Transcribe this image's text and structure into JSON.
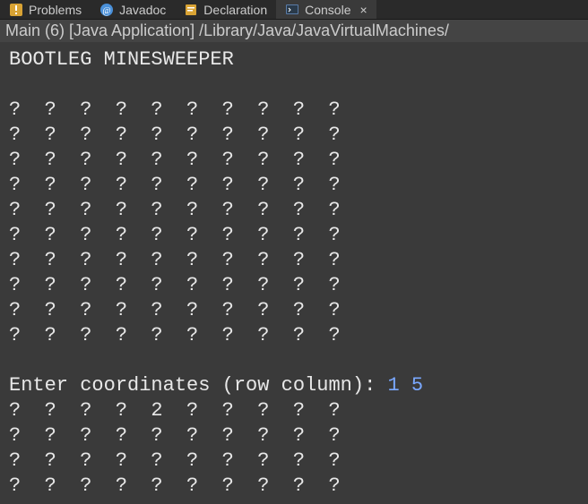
{
  "tabs": {
    "problems": "Problems",
    "javadoc": "Javadoc",
    "declaration": "Declaration",
    "console": "Console"
  },
  "launch_info": "Main (6) [Java Application] /Library/Java/JavaVirtualMachines/",
  "console_output": {
    "title": "BOOTLEG MINESWEEPER",
    "blank1": "",
    "row0": "?  ?  ?  ?  ?  ?  ?  ?  ?  ?",
    "row1": "?  ?  ?  ?  ?  ?  ?  ?  ?  ?",
    "row2": "?  ?  ?  ?  ?  ?  ?  ?  ?  ?",
    "row3": "?  ?  ?  ?  ?  ?  ?  ?  ?  ?",
    "row4": "?  ?  ?  ?  ?  ?  ?  ?  ?  ?",
    "row5": "?  ?  ?  ?  ?  ?  ?  ?  ?  ?",
    "row6": "?  ?  ?  ?  ?  ?  ?  ?  ?  ?",
    "row7": "?  ?  ?  ?  ?  ?  ?  ?  ?  ?",
    "row8": "?  ?  ?  ?  ?  ?  ?  ?  ?  ?",
    "row9": "?  ?  ?  ?  ?  ?  ?  ?  ?  ?",
    "blank2": "",
    "prompt": "Enter coordinates (row column): ",
    "input": "1 5",
    "out0": "?  ?  ?  ?  2  ?  ?  ?  ?  ?",
    "out1": "?  ?  ?  ?  ?  ?  ?  ?  ?  ?",
    "out2": "?  ?  ?  ?  ?  ?  ?  ?  ?  ?",
    "out3": "?  ?  ?  ?  ?  ?  ?  ?  ?  ?"
  }
}
